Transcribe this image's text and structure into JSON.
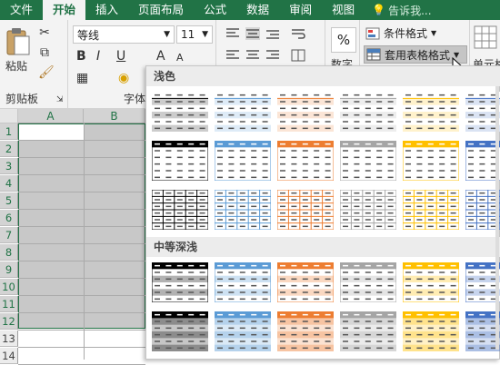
{
  "tabs": [
    "文件",
    "开始",
    "插入",
    "页面布局",
    "公式",
    "数据",
    "审阅",
    "视图"
  ],
  "tellme": "告诉我...",
  "clipboard": {
    "paste": "粘贴",
    "group": "剪贴板"
  },
  "font": {
    "name": "等线",
    "size": "11",
    "grow": "A",
    "shrink": "A",
    "bold": "B",
    "italic": "I",
    "underline": "U",
    "group": "字体"
  },
  "number": {
    "pct": "%",
    "label": "数字"
  },
  "styles": {
    "conditional": "条件格式",
    "table": "套用表格格式",
    "cell": "单元格"
  },
  "columns": [
    "A",
    "B"
  ],
  "rows": [
    "1",
    "2",
    "3",
    "4",
    "5",
    "6",
    "7",
    "8",
    "9",
    "10",
    "11",
    "12",
    "13",
    "14"
  ],
  "gallery": {
    "light": "浅色",
    "medium": "中等深浅"
  },
  "colors": {
    "ribbon": "#217346",
    "blue": "#5b9bd5",
    "orange": "#ed7d31",
    "gray": "#a5a5a5",
    "gold": "#ffc000",
    "darkblue": "#4472c4",
    "green": "#70ad47",
    "black": "#000000"
  }
}
